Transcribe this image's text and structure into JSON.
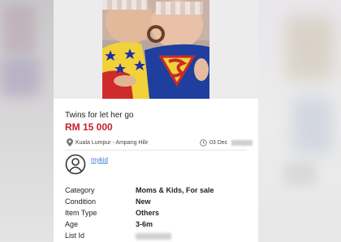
{
  "listing": {
    "title": "Twins for let her go",
    "price": "RM 15 000",
    "location": "Kuala Lumpur - Ampang Hilir",
    "date": "03 Dec",
    "seller": "mykid",
    "attributes": [
      {
        "label": "Category",
        "value": "Moms & Kids, For sale"
      },
      {
        "label": "Condition",
        "value": "New"
      },
      {
        "label": "Item Type",
        "value": "Others"
      },
      {
        "label": "Age",
        "value": "3-6m"
      },
      {
        "label": "List Id",
        "value": ""
      }
    ]
  },
  "icons": {
    "location": "location-pin-icon",
    "date": "clock-icon",
    "avatar": "user-avatar-icon"
  },
  "colors": {
    "price": "#c41f2c",
    "seller_link": "#3a7bd5"
  }
}
